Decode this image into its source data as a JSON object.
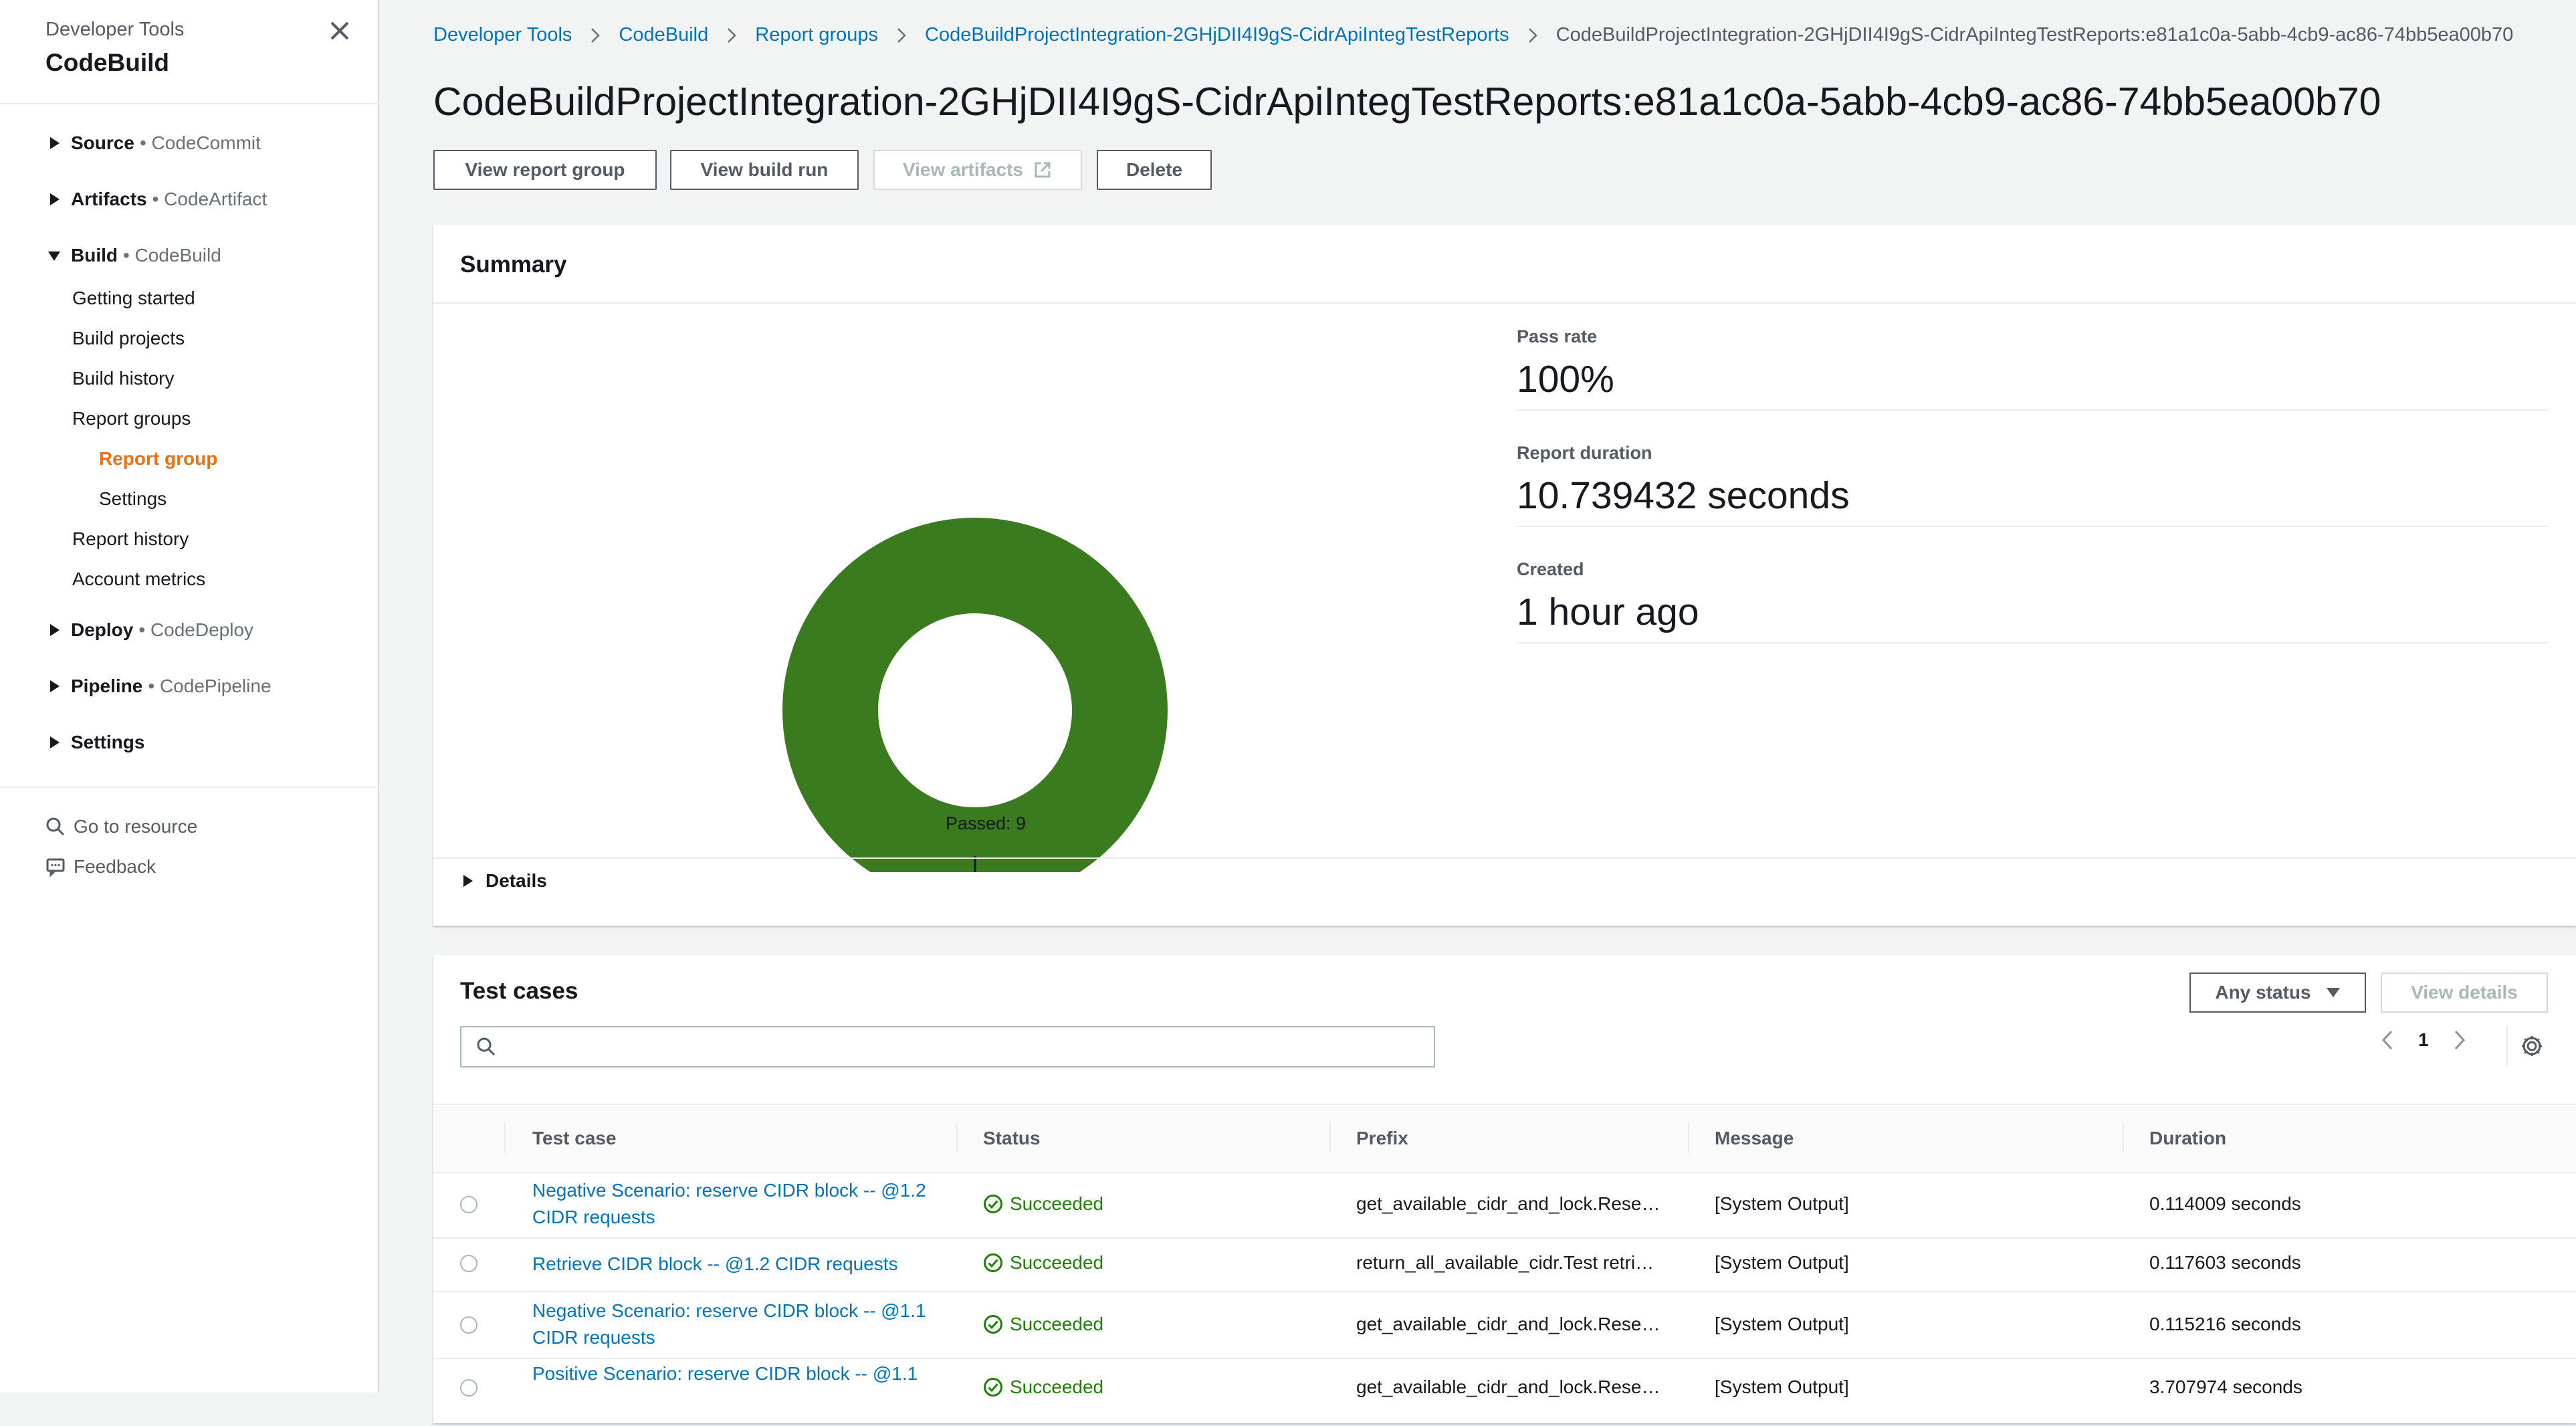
{
  "sidebar": {
    "subtitle": "Developer Tools",
    "title": "CodeBuild",
    "sections": {
      "source": {
        "name": "Source",
        "service": "• CodeCommit"
      },
      "artifacts": {
        "name": "Artifacts",
        "service": "• CodeArtifact"
      },
      "build": {
        "name": "Build",
        "service": "• CodeBuild"
      },
      "deploy": {
        "name": "Deploy",
        "service": "• CodeDeploy"
      },
      "pipeline": {
        "name": "Pipeline",
        "service": "• CodePipeline"
      },
      "settings": {
        "name": "Settings"
      }
    },
    "build_items": [
      "Getting started",
      "Build projects",
      "Build history",
      "Report groups",
      "Report group",
      "Settings",
      "Report history",
      "Account metrics"
    ],
    "go_to_resource": "Go to resource",
    "feedback": "Feedback"
  },
  "breadcrumbs": [
    "Developer Tools",
    "CodeBuild",
    "Report groups",
    "CodeBuildProjectIntegration-2GHjDII4I9gS-CidrApiIntegTestReports",
    "CodeBuildProjectIntegration-2GHjDII4I9gS-CidrApiIntegTestReports:e81a1c0a-5abb-4cb9-ac86-74bb5ea00b70"
  ],
  "page_title": "CodeBuildProjectIntegration-2GHjDII4I9gS-CidrApiIntegTestReports:e81a1c0a-5abb-4cb9-ac86-74bb5ea00b70",
  "actions": {
    "view_report_group": "View report group",
    "view_build_run": "View build run",
    "view_artifacts": "View artifacts",
    "delete": "Delete"
  },
  "summary": {
    "heading": "Summary",
    "pass_rate_label": "Pass rate",
    "pass_rate_value": "100%",
    "duration_label": "Report duration",
    "duration_value": "10.739432 seconds",
    "created_label": "Created",
    "created_value": "1 hour ago",
    "details_label": "Details"
  },
  "chart_data": {
    "type": "pie",
    "donut": true,
    "categories": [
      "Passed"
    ],
    "values": [
      9
    ],
    "data_labels": [
      "9"
    ],
    "legend": [
      "Passed: 9"
    ],
    "legend_position": "bottom",
    "colors": [
      "#3b7b1f"
    ]
  },
  "test_cases": {
    "heading": "Test cases",
    "status_filter": "Any status",
    "view_details": "View details",
    "search_value": "",
    "page": "1",
    "columns": [
      "Test case",
      "Status",
      "Prefix",
      "Message",
      "Duration"
    ],
    "rows": [
      {
        "name": "Negative Scenario: reserve CIDR block -- @1.2 CIDR requests",
        "status": "Succeeded",
        "prefix": "get_available_cidr_and_lock.Rese…",
        "message": "[System Output]",
        "duration": "0.114009 seconds"
      },
      {
        "name": "Retrieve CIDR block -- @1.2 CIDR requests",
        "status": "Succeeded",
        "prefix": "return_all_available_cidr.Test retri…",
        "message": "[System Output]",
        "duration": "0.117603 seconds"
      },
      {
        "name": "Negative Scenario: reserve CIDR block -- @1.1 CIDR requests",
        "status": "Succeeded",
        "prefix": "get_available_cidr_and_lock.Rese…",
        "message": "[System Output]",
        "duration": "0.115216 seconds"
      },
      {
        "name": "Positive Scenario: reserve CIDR block -- @1.1",
        "status": "Succeeded",
        "prefix": "get_available_cidr_and_lock.Rese…",
        "message": "[System Output]",
        "duration": "3.707974 seconds"
      }
    ]
  },
  "colors": {
    "link": "#0073bb",
    "accent": "#ec7211",
    "success": "#1d8102",
    "chart_green": "#3b7b1f"
  }
}
